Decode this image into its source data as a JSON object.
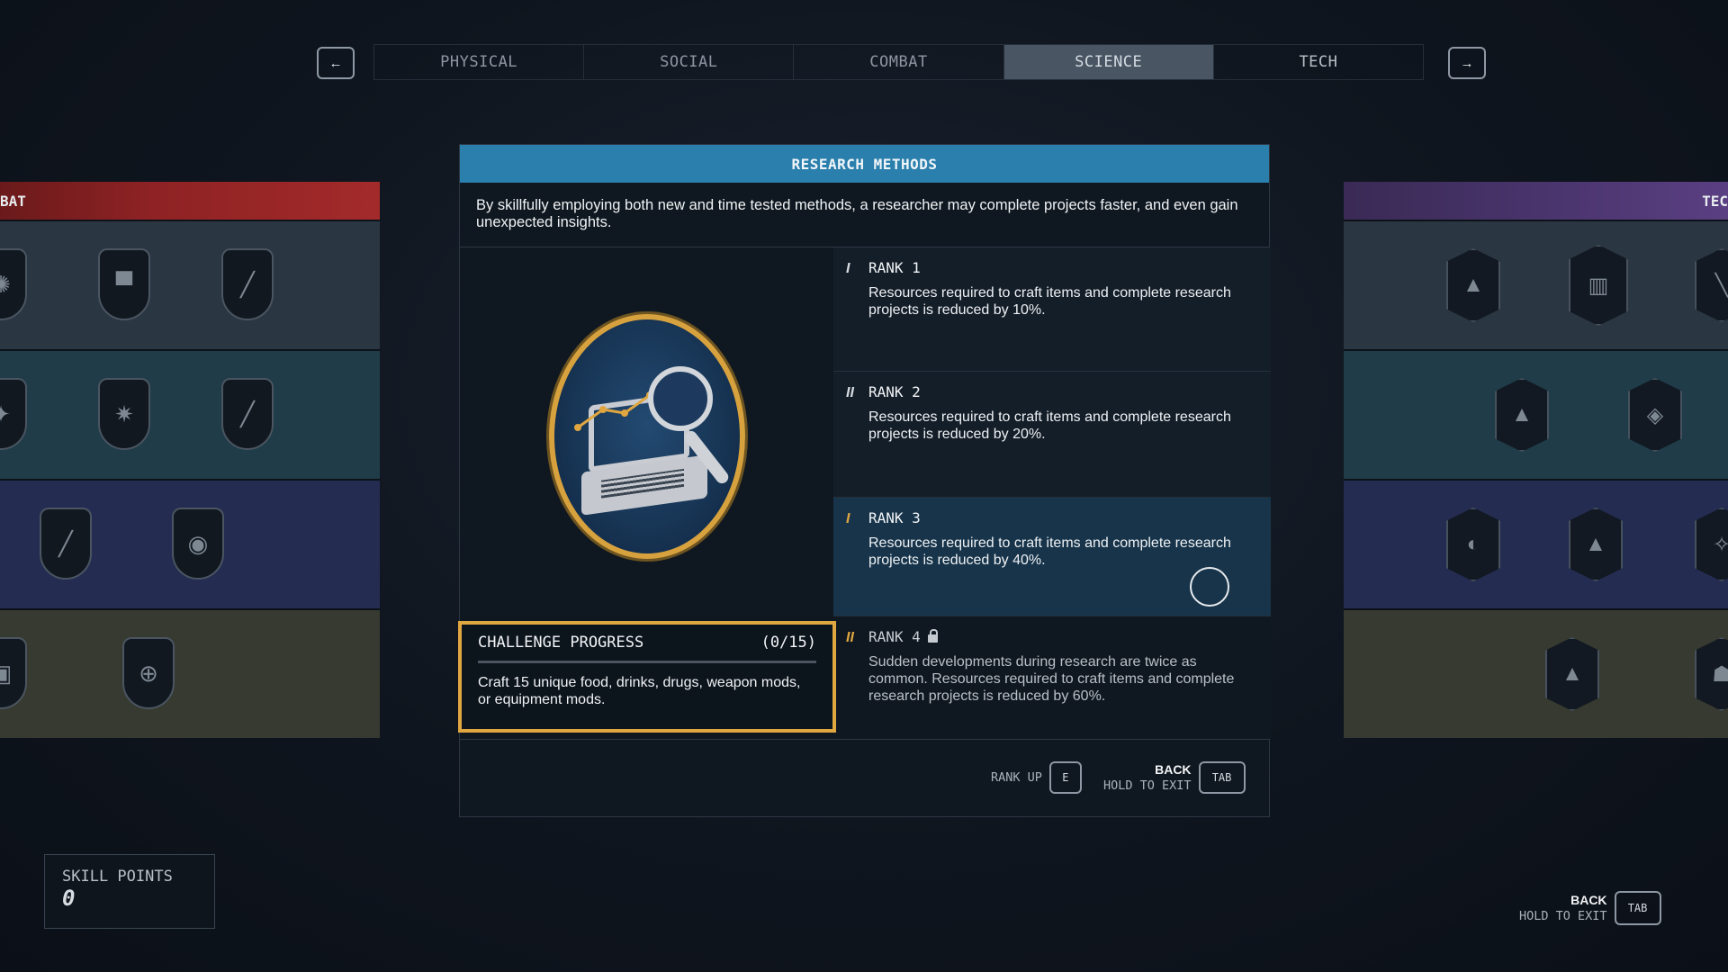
{
  "nav": {
    "prev_icon": "arrow-left-icon",
    "next_icon": "arrow-right-icon",
    "prev_glyph": "←",
    "next_glyph": "→"
  },
  "tabs": [
    {
      "label": "PHYSICAL",
      "active": false
    },
    {
      "label": "SOCIAL",
      "active": false
    },
    {
      "label": "COMBAT",
      "active": false
    },
    {
      "label": "SCIENCE",
      "active": true
    },
    {
      "label": "TECH",
      "active": false
    }
  ],
  "left_panel": {
    "header": "BAT",
    "color": "#8e2224"
  },
  "right_panel": {
    "header": "TEC",
    "color": "#4c3670"
  },
  "skill": {
    "title": "RESEARCH METHODS",
    "description": "By skillfully employing both new and time tested methods, a researcher may complete projects faster, and even gain unexpected insights.",
    "accent": "#2a7fad",
    "ranks": [
      {
        "mark": "I",
        "title": "RANK 1",
        "text": "Resources required to craft items and complete research projects is reduced by 10%."
      },
      {
        "mark": "II",
        "title": "RANK 2",
        "text": "Resources required to craft items and complete research projects is reduced by 20%."
      },
      {
        "mark": "I",
        "title": "RANK 3",
        "text": "Resources required to craft items and complete research projects is reduced by 40%."
      },
      {
        "mark": "II",
        "title": "RANK 4",
        "text": "Sudden developments during research are twice as common. Resources required to craft items and complete research projects is reduced by 60%.",
        "locked": true
      }
    ]
  },
  "challenge": {
    "title": "CHALLENGE PROGRESS",
    "progress": "(0/15)",
    "text": "Craft 15 unique food, drinks, drugs, weapon mods, or equipment mods."
  },
  "footer": {
    "rank_up_label": "RANK UP",
    "rank_up_key": "E",
    "back_label": "BACK",
    "hold_label": "HOLD TO EXIT",
    "back_key": "TAB"
  },
  "skill_points": {
    "label": "SKILL POINTS",
    "value": "0"
  },
  "global_footer": {
    "back_label": "BACK",
    "hold_label": "HOLD TO EXIT",
    "key": "TAB"
  }
}
